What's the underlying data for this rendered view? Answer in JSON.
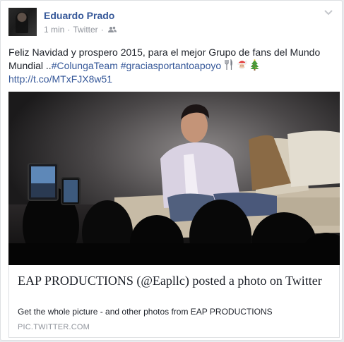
{
  "post": {
    "author": "Eduardo Prado",
    "time": "1 min",
    "dot1": "·",
    "source": "Twitter",
    "dot2": "·",
    "text_plain": "Feliz Navidad y prospero 2015, para el mejor Grupo de fans del Mundo Mundial ..",
    "hashtag1": "#ColungaTeam",
    "hashtag2": "#graciasportantoapoyo",
    "link": "http://t.co/MTxFJX8w51",
    "audience_icon": "friends-icon",
    "emoji": [
      "fork-knife-icon",
      "santa-icon",
      "christmas-tree-icon"
    ]
  },
  "attachment": {
    "title": "EAP PRODUCTIONS (@Eapllc) posted a photo on Twitter",
    "description": "Get the whole picture - and other photos from EAP PRODUCTIONS",
    "domain": "PIC.TWITTER.COM"
  },
  "colors": {
    "link": "#365899",
    "meta": "#90949c",
    "text": "#1d2129",
    "border": "#dddfe2"
  }
}
